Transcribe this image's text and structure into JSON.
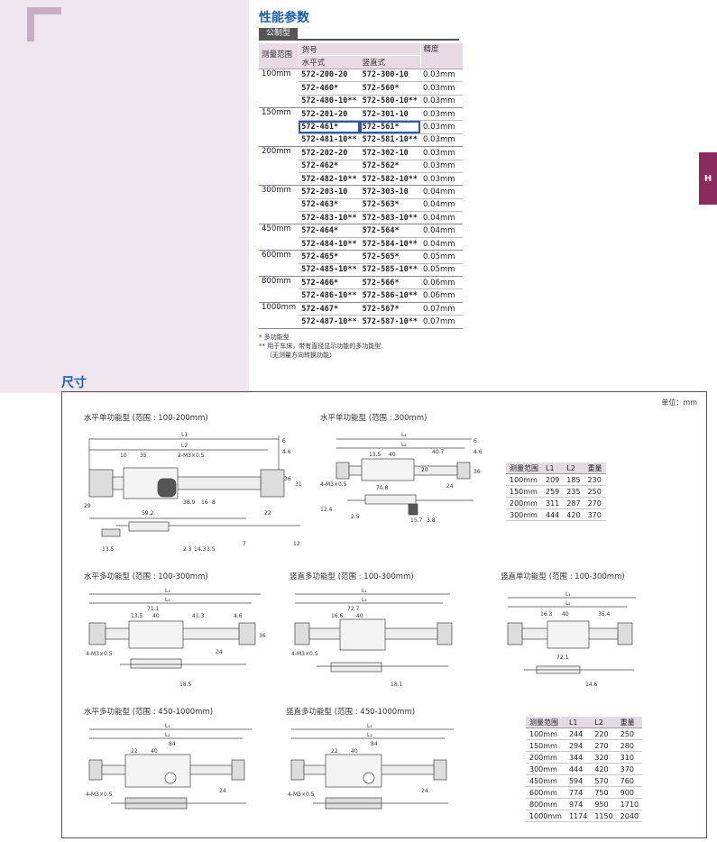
{
  "spec_section": {
    "title": "性能参数",
    "tag": "公制型",
    "headers": {
      "range": "测量范围",
      "model": "货号",
      "horizontal": "水平式",
      "vertical": "竖直式",
      "accuracy": "精度"
    },
    "groups": [
      {
        "range": "100mm",
        "rows": [
          [
            "572-200-20",
            "572-300-10",
            "0.03mm"
          ],
          [
            "572-460*",
            "572-560*",
            "0.03mm"
          ],
          [
            "572-480-10**",
            "572-580-10**",
            "0.03mm"
          ]
        ]
      },
      {
        "range": "150mm",
        "rows": [
          [
            "572-201-20",
            "572-301-10",
            "0.03mm"
          ],
          [
            "572-461*",
            "572-561*",
            "0.03mm"
          ],
          [
            "572-481-10**",
            "572-581-10**",
            "0.03mm"
          ]
        ]
      },
      {
        "range": "200mm",
        "rows": [
          [
            "572-202-20",
            "572-302-10",
            "0.03mm"
          ],
          [
            "572-462*",
            "572-562*",
            "0.03mm"
          ],
          [
            "572-482-10**",
            "572-582-10**",
            "0.03mm"
          ]
        ]
      },
      {
        "range": "300mm",
        "rows": [
          [
            "572-203-10",
            "572-303-10",
            "0.04mm"
          ],
          [
            "572-463*",
            "572-563*",
            "0.04mm"
          ],
          [
            "572-483-10**",
            "572-583-10**",
            "0.04mm"
          ]
        ]
      },
      {
        "range": "450mm",
        "rows": [
          [
            "572-464*",
            "572-564*",
            "0.04mm"
          ],
          [
            "572-484-10**",
            "572-584-10**",
            "0.04mm"
          ]
        ]
      },
      {
        "range": "600mm",
        "rows": [
          [
            "572-465*",
            "572-565*",
            "0.05mm"
          ],
          [
            "572-485-10**",
            "572-585-10**",
            "0.05mm"
          ]
        ]
      },
      {
        "range": "800mm",
        "rows": [
          [
            "572-466*",
            "572-566*",
            "0.06mm"
          ],
          [
            "572-486-10**",
            "572-586-10**",
            "0.06mm"
          ]
        ]
      },
      {
        "range": "1000mm",
        "rows": [
          [
            "572-467*",
            "572-567*",
            "0.07mm"
          ],
          [
            "572-487-10**",
            "572-587-10**",
            "0.07mm"
          ]
        ]
      }
    ],
    "notes": [
      "* 多功能型",
      "** 用于车床，带有直径显示功能的多功能型",
      "（无测量方向转换功能）"
    ]
  },
  "side_tab": "H",
  "dims_section": {
    "title": "尺寸",
    "unit": "单位：mm",
    "titles": {
      "d1": "水平单功能型 (范围 : 100-200mm)",
      "d2": "水平单功能型 (范围 : 300mm)",
      "d3": "水平多功能型 (范围 : 100-300mm)",
      "d4": "竖直多功能型 (范围 : 100-300mm)",
      "d5": "竖直单功能型 (范围 : 100-300mm)",
      "d6": "水平多功能型 (范围 : 450-1000mm)",
      "d7": "竖直多功能型 (范围 : 450-1000mm)"
    },
    "table1": {
      "headers": [
        "测量范围",
        "L1",
        "L2",
        "重量"
      ],
      "rows": [
        [
          "100mm",
          "209",
          "185",
          "230"
        ],
        [
          "150mm",
          "259",
          "235",
          "250"
        ],
        [
          "200mm",
          "311",
          "287",
          "270"
        ],
        [
          "300mm",
          "444",
          "420",
          "370"
        ]
      ]
    },
    "table2": {
      "headers": [
        "测量范围",
        "L1",
        "L2",
        "重量"
      ],
      "rows": [
        [
          "100mm",
          "244",
          "220",
          "250"
        ],
        [
          "150mm",
          "294",
          "270",
          "280"
        ],
        [
          "200mm",
          "344",
          "320",
          "310"
        ],
        [
          "300mm",
          "444",
          "420",
          "370"
        ],
        [
          "450mm",
          "594",
          "570",
          "760"
        ],
        [
          "600mm",
          "774",
          "750",
          "900"
        ],
        [
          "800mm",
          "974",
          "950",
          "1710"
        ],
        [
          "1000mm",
          "1174",
          "1150",
          "2040"
        ]
      ]
    },
    "labels": {
      "L1": "L1",
      "L2": "L2",
      "L1b": "L₁",
      "L2b": "L₂",
      "m3": "2-M3×0.5",
      "m3b": "4-M3×0.5",
      "n6": "6",
      "n46": "4.6",
      "n10": "10",
      "n35": "35",
      "n36": "36",
      "n31": "31",
      "n29": "29",
      "n389": "38.9",
      "n16": "16",
      "n8": "8",
      "n592": "59.2",
      "n22": "22",
      "n135": "13.5",
      "n23": "2.3",
      "n143": "14.3",
      "n35b": "3.5",
      "n7": "7",
      "n12": "12",
      "n40": "40",
      "n407": "40.7",
      "n20": "20",
      "n66": "6.6",
      "n708": "70.8",
      "n24": "24",
      "n124": "12.4",
      "n25": "2.5",
      "n157": "15.7",
      "n38": "3.8",
      "n711": "71.1",
      "n413": "41.3",
      "n185": "18.5",
      "n727": "72.7",
      "n166": "16.6",
      "n181": "18.1",
      "n163": "16.3",
      "n354": "35.4",
      "n721": "72.1",
      "n146": "14.6",
      "n84": "84",
      "n42": "42",
      "n9": "9"
    }
  }
}
